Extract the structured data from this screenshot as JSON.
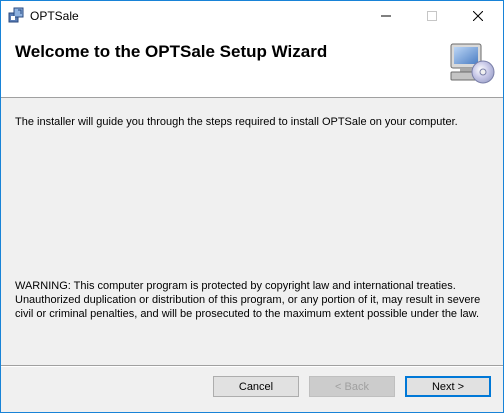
{
  "window": {
    "title": "OPTSale",
    "app_icon": "installer-icon",
    "controls": {
      "minimize": "minimize-icon",
      "maximize": "maximize-icon",
      "close": "close-icon"
    }
  },
  "header": {
    "title": "Welcome to the OPTSale Setup Wizard",
    "icon": "computer-cd-icon"
  },
  "body": {
    "intro": "The installer will guide you through the steps required to install OPTSale on your computer.",
    "warning": "WARNING: This computer program is protected by copyright law and international treaties. Unauthorized duplication or distribution of this program, or any portion of it, may result in severe civil or criminal penalties, and will be prosecuted to the maximum extent possible under the law."
  },
  "buttons": {
    "cancel": "Cancel",
    "back": "< Back",
    "next": "Next >"
  },
  "colors": {
    "window_border": "#1883d7",
    "dialog_bg": "#f0f0f0",
    "default_button_border": "#0078d7"
  }
}
